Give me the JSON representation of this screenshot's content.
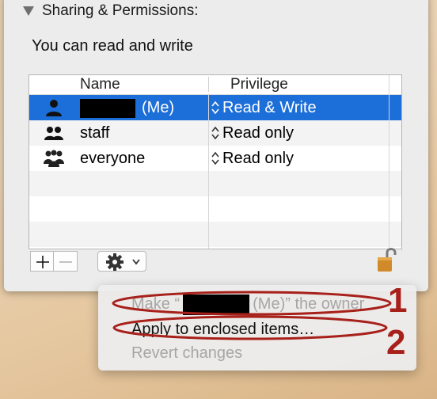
{
  "section": {
    "title": "Sharing & Permissions:"
  },
  "status": {
    "text": "You can read and write"
  },
  "table": {
    "headers": {
      "name": "Name",
      "privilege": "Privilege"
    },
    "rows": [
      {
        "name_suffix": "(Me)",
        "privilege": "Read & Write",
        "icon": "single-user-icon",
        "selected": true
      },
      {
        "name": "staff",
        "privilege": "Read only",
        "icon": "group-icon",
        "selected": false
      },
      {
        "name": "everyone",
        "privilege": "Read only",
        "icon": "everyone-icon",
        "selected": false
      }
    ]
  },
  "toolbar": {
    "add": "+",
    "remove": "−",
    "action_menu_icon": "gear-icon"
  },
  "menu": {
    "items": [
      {
        "prefix": "Make “",
        "suffix": "(Me)” the owner",
        "enabled": false
      },
      {
        "label": "Apply to enclosed items…",
        "enabled": true
      },
      {
        "label": "Revert changes",
        "enabled": false
      }
    ]
  },
  "annotations": {
    "one": "1",
    "two": "2"
  },
  "colors": {
    "selection": "#1c6ed8",
    "annotation": "#a8201a",
    "lock": "#d08a2a"
  }
}
